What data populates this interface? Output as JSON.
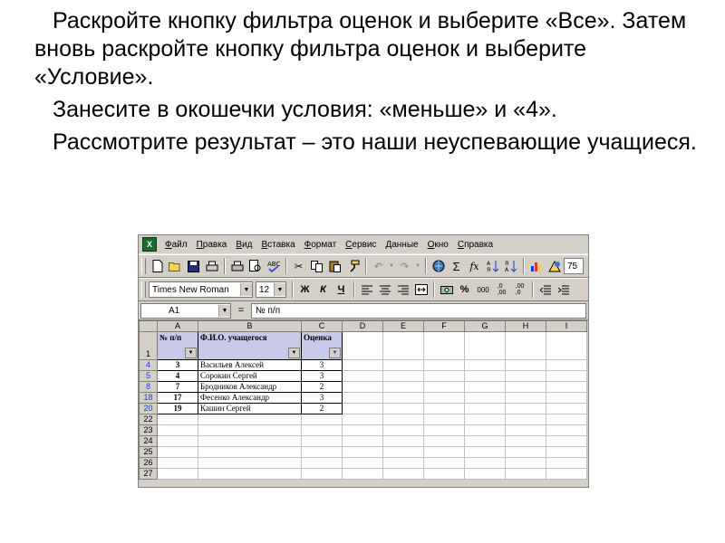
{
  "instructions": {
    "p1": "Раскройте кнопку фильтра оценок и выберите «Все». Затем вновь раскройте кнопку фильтра оценок и выберите «Условие».",
    "p2": "Занесите в окошечки  условия: «меньше»  и  «4».",
    "p3": "Рассмотрите результат – это наши неуспевающие учащиеся."
  },
  "excel": {
    "menu": [
      "Файл",
      "Правка",
      "Вид",
      "Вставка",
      "Формат",
      "Сервис",
      "Данные",
      "Окно",
      "Справка"
    ],
    "toolbar1": {
      "icons": [
        "new-file-icon",
        "open-folder-icon",
        "save-icon",
        "print-preview-icon",
        "print-icon",
        "preview-icon",
        "spelling-icon",
        "cut-icon",
        "copy-icon",
        "paste-icon",
        "format-painter-icon",
        "undo-icon",
        "redo-icon",
        "hyperlink-icon",
        "autosum-icon",
        "function-icon",
        "sort-ascending-icon",
        "sort-descending-icon",
        "chart-wizard-icon",
        "drawing-icon"
      ],
      "zoom": "75"
    },
    "toolbar2": {
      "font": "Times New Roman",
      "size": "12",
      "bold": "Ж",
      "italic": "К",
      "underline": "Ч",
      "percent": "%",
      "thousands": "000"
    },
    "formula_bar": {
      "name_box": "A1",
      "eq": "=",
      "formula": "№ п/п"
    },
    "grid": {
      "columns": [
        "A",
        "B",
        "C",
        "D",
        "E",
        "F",
        "G",
        "H",
        "I"
      ],
      "header_row": "1",
      "headers": [
        "№ п/п",
        "Ф.И.О. учащегося",
        "Оценка"
      ],
      "rows": [
        {
          "row": "4",
          "num": "3",
          "name": "Васильев Алексей",
          "grade": "3"
        },
        {
          "row": "5",
          "num": "4",
          "name": "Сорокин Сергей",
          "grade": "3"
        },
        {
          "row": "8",
          "num": "7",
          "name": "Бродников Александр",
          "grade": "2"
        },
        {
          "row": "18",
          "num": "17",
          "name": "Фесенко Александр",
          "grade": "3"
        },
        {
          "row": "20",
          "num": "19",
          "name": "Кашин Сергей",
          "grade": "2"
        }
      ],
      "empty_rows": [
        "22",
        "23",
        "24",
        "25",
        "26",
        "27"
      ]
    },
    "colors": {
      "header_fill": "#c8c8e8",
      "filtered_row_number": "#1a3bd6",
      "chrome": "#d4d0c8"
    }
  }
}
